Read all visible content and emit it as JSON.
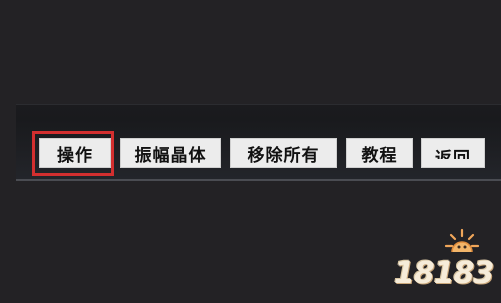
{
  "toolbar": {
    "buttons": [
      {
        "label": "操作"
      },
      {
        "label": "振幅晶体"
      },
      {
        "label": "移除所有"
      },
      {
        "label": "教程"
      },
      {
        "label": "返回"
      }
    ]
  },
  "watermark": {
    "text": "18183"
  },
  "colors": {
    "background": "#232225",
    "button_bg": "#ececec",
    "highlight": "#d32f2f"
  }
}
